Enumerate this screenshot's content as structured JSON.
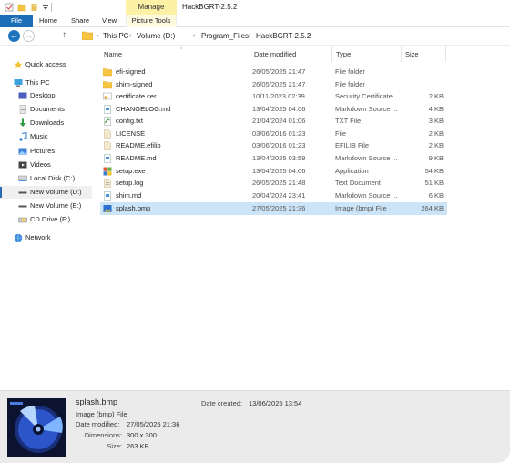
{
  "window": {
    "title": "HackBGRT-2.5.2",
    "manage_tab": "Manage"
  },
  "ribbon": {
    "tabs": [
      {
        "label": "File"
      },
      {
        "label": "Home"
      },
      {
        "label": "Share"
      },
      {
        "label": "View"
      },
      {
        "label": "Picture Tools"
      }
    ]
  },
  "address": {
    "crumbs": [
      "This PC",
      "Volume (D:)",
      "Program_Files",
      "HackBGRT-2.5.2"
    ]
  },
  "sidebar": {
    "items": [
      {
        "label": "Quick access",
        "icon": "star-icon"
      },
      {
        "label": "This PC",
        "icon": "computer-icon"
      },
      {
        "label": "Desktop",
        "icon": "desktop-icon"
      },
      {
        "label": "Documents",
        "icon": "documents-icon"
      },
      {
        "label": "Downloads",
        "icon": "downloads-icon"
      },
      {
        "label": "Music",
        "icon": "music-icon"
      },
      {
        "label": "Pictures",
        "icon": "pictures-icon"
      },
      {
        "label": "Videos",
        "icon": "videos-icon"
      },
      {
        "label": "Local Disk (C:)",
        "icon": "drive-icon"
      },
      {
        "label": "New Volume (D:)",
        "icon": "drive-icon"
      },
      {
        "label": "New Volume (E:)",
        "icon": "drive-icon"
      },
      {
        "label": "CD Drive (F:)",
        "icon": "cd-drive-icon"
      },
      {
        "label": "Network",
        "icon": "network-icon"
      }
    ]
  },
  "columns": {
    "name": "Name",
    "date": "Date modified",
    "type": "Type",
    "size": "Size"
  },
  "files": [
    {
      "name": "efi-signed",
      "date": "26/05/2025 21:47",
      "type": "File folder",
      "size": "",
      "icon": "folder-icon"
    },
    {
      "name": "shim-signed",
      "date": "26/05/2025 21:47",
      "type": "File folder",
      "size": "",
      "icon": "folder-icon"
    },
    {
      "name": "certificate.cer",
      "date": "10/11/2023 02:39",
      "type": "Security Certificate",
      "size": "2 KB",
      "icon": "certificate-icon"
    },
    {
      "name": "CHANGELOG.md",
      "date": "13/04/2025 04:06",
      "type": "Markdown Source ...",
      "size": "4 KB",
      "icon": "markdown-file-icon"
    },
    {
      "name": "config.txt",
      "date": "21/04/2024 01:06",
      "type": "TXT File",
      "size": "3 KB",
      "icon": "text-file-icon"
    },
    {
      "name": "LICENSE",
      "date": "03/06/2016 01:23",
      "type": "File",
      "size": "2 KB",
      "icon": "file-icon"
    },
    {
      "name": "README.efilib",
      "date": "03/06/2016 01:23",
      "type": "EFILIB File",
      "size": "2 KB",
      "icon": "file-icon"
    },
    {
      "name": "README.md",
      "date": "13/04/2025 03:59",
      "type": "Markdown Source ...",
      "size": "9 KB",
      "icon": "markdown-file-icon"
    },
    {
      "name": "setup.exe",
      "date": "13/04/2025 04:06",
      "type": "Application",
      "size": "54 KB",
      "icon": "application-icon"
    },
    {
      "name": "setup.log",
      "date": "26/05/2025 21:48",
      "type": "Text Document",
      "size": "51 KB",
      "icon": "text-file-icon"
    },
    {
      "name": "shim.md",
      "date": "20/04/2024 23:41",
      "type": "Markdown Source ...",
      "size": "6 KB",
      "icon": "markdown-file-icon"
    },
    {
      "name": "splash.bmp",
      "date": "27/05/2025 21:36",
      "type": "Image (bmp) File",
      "size": "264 KB",
      "icon": "bitmap-image-icon"
    }
  ],
  "details": {
    "filename": "splash.bmp",
    "type": "Image (bmp) File",
    "modified_label": "Date modified:",
    "modified_value": "27/05/2025 21:36",
    "dimensions_label": "Dimensions:",
    "dimensions_value": "300 x 300",
    "size_label": "Size:",
    "size_value": "263 KB",
    "created_label": "Date created:",
    "created_value": "13/06/2025 13:54"
  }
}
